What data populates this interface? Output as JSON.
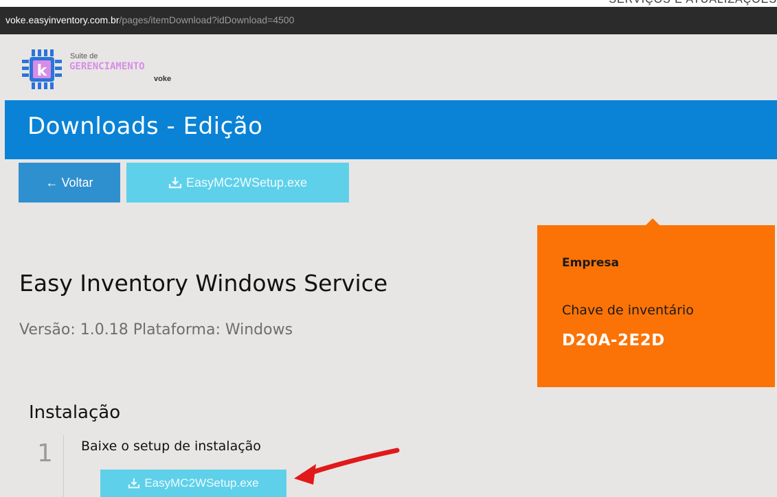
{
  "top_strip": {
    "cut_text": "SERVIÇOS  E  ATUALIZAÇÕES"
  },
  "browser": {
    "url_host": "voke.easyinventory.com.br",
    "url_path": "/pages/itemDownload?idDownload=4500"
  },
  "logo": {
    "line1": "Suite de",
    "line2": "GERENCIAMENTO",
    "line3": "voke",
    "icon_letter": "k",
    "colors": {
      "pink": "#d78de8",
      "blue": "#2b74d9"
    }
  },
  "header": {
    "title": "Downloads - Edição",
    "background": "#0a83d6"
  },
  "toolbar": {
    "back_label": "← Voltar",
    "setup_label": "EasyMC2WSetup.exe"
  },
  "product": {
    "title": "Easy Inventory Windows Service",
    "meta": "Versão: 1.0.18 Plataforma: Windows"
  },
  "info_box": {
    "company_label": "Empresa",
    "key_label": "Chave de inventário",
    "key_value": "D20A-2E2D",
    "background": "#fb7306"
  },
  "install": {
    "section_title": "Instalação",
    "steps": [
      {
        "number": "1",
        "text": "Baixe o setup de instalação",
        "button_label": "EasyMC2WSetup.exe"
      }
    ]
  },
  "icons": {
    "download": "download-icon",
    "annotation": "red-arrow-icon"
  }
}
